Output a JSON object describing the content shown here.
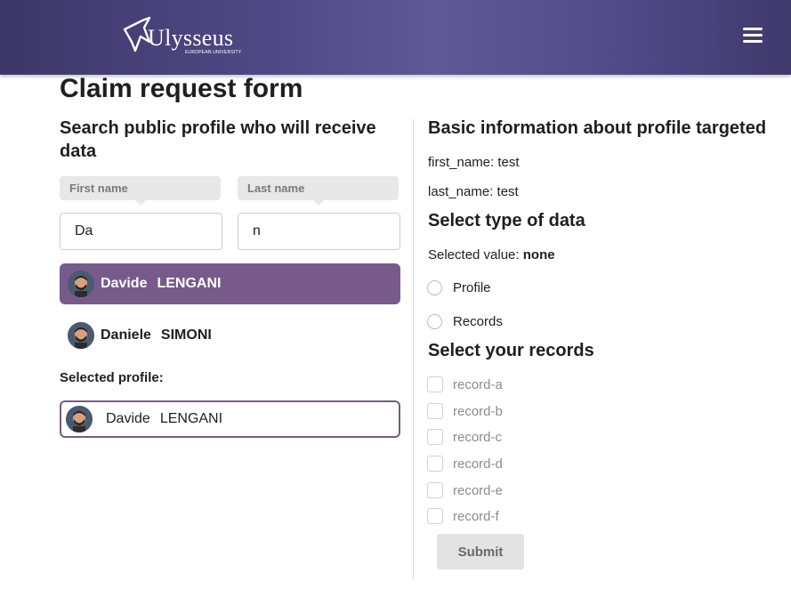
{
  "header": {
    "logo_text": "Ulysseus",
    "logo_subtitle": "EUROPEAN UNIVERSITY",
    "menu_icon": "hamburger-icon",
    "gradient_color": "#4f4a86"
  },
  "page_title": "Claim request form",
  "search": {
    "heading": "Search public profile who will receive data",
    "first_name_tip": "First name",
    "last_name_tip": "Last name",
    "first_name_value": "Da",
    "last_name_value": "n",
    "results": [
      {
        "first": "Davide",
        "last": "LENGANI",
        "selected": true
      },
      {
        "first": "Daniele",
        "last": "SIMONI",
        "selected": false
      }
    ],
    "accent_color": "#775a8a"
  },
  "selected_profile": {
    "label": "Selected profile:",
    "first": "Davide",
    "last": "LENGANI"
  },
  "info": {
    "heading": "Basic information about profile targeted",
    "first_name_line": "first_name: test",
    "last_name_line": "last_name: test"
  },
  "data_type": {
    "heading": "Select type of data",
    "selected_prefix": "Selected value: ",
    "selected_value": "none",
    "options": [
      "Profile",
      "Records"
    ]
  },
  "records": {
    "heading": "Select your records",
    "items": [
      "record-a",
      "record-b",
      "record-c",
      "record-d",
      "record-e",
      "record-f"
    ]
  },
  "submit_label": "Submit"
}
